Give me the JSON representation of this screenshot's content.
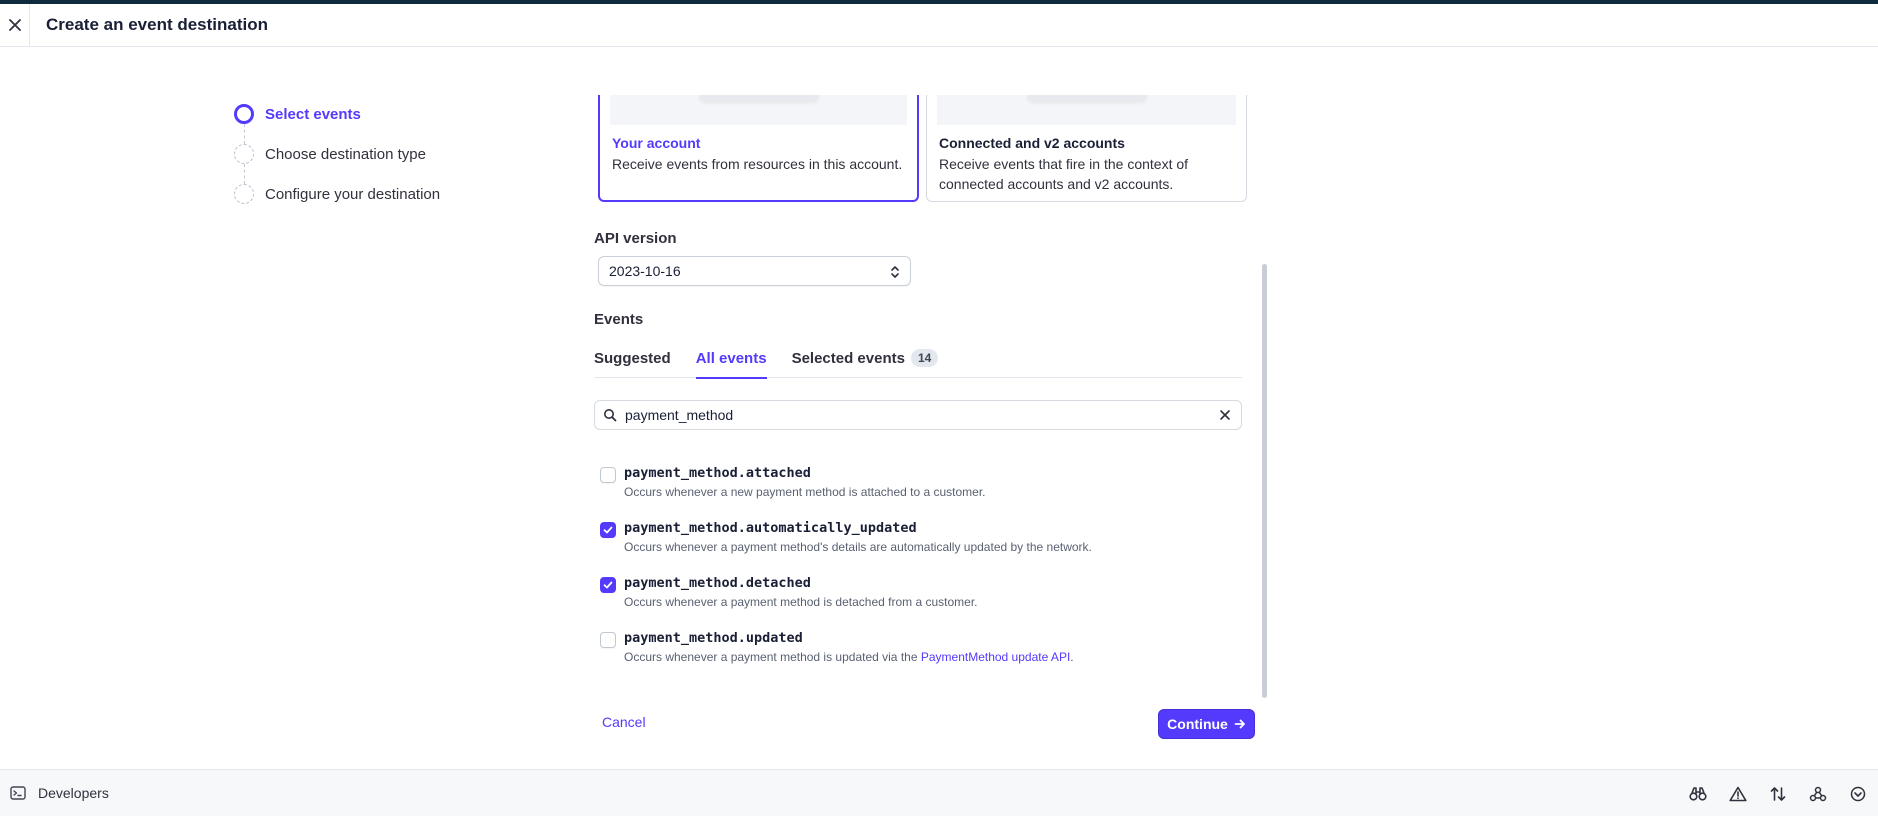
{
  "header": {
    "title": "Create an event destination"
  },
  "steps": [
    {
      "label": "Select events"
    },
    {
      "label": "Choose destination type"
    },
    {
      "label": "Configure your destination"
    }
  ],
  "cards": {
    "your_account": {
      "title": "Your account",
      "desc": "Receive events from resources in this account."
    },
    "connected": {
      "title": "Connected and v2 accounts",
      "desc": "Receive events that fire in the context of connected accounts and v2 accounts."
    }
  },
  "api": {
    "label": "API version",
    "value": "2023-10-16"
  },
  "events": {
    "label": "Events",
    "tabs": {
      "suggested": "Suggested",
      "all": "All events",
      "selected": "Selected events",
      "selected_count": "14"
    },
    "search_value": "payment_method",
    "items": [
      {
        "name": "payment_method.attached",
        "desc": "Occurs whenever a new payment method is attached to a customer.",
        "checked": false
      },
      {
        "name": "payment_method.automatically_updated",
        "desc": "Occurs whenever a payment method's details are automatically updated by the network.",
        "checked": true
      },
      {
        "name": "payment_method.detached",
        "desc": "Occurs whenever a payment method is detached from a customer.",
        "checked": true
      },
      {
        "name": "payment_method.updated",
        "desc_prefix": "Occurs whenever a payment method is updated via the ",
        "desc_link": "PaymentMethod update API",
        "desc_suffix": ".",
        "checked": false
      }
    ]
  },
  "actions": {
    "cancel": "Cancel",
    "continue": "Continue"
  },
  "footer": {
    "label": "Developers"
  },
  "colors": {
    "accent": "#533afd",
    "stripe": "#0f2a3d"
  }
}
